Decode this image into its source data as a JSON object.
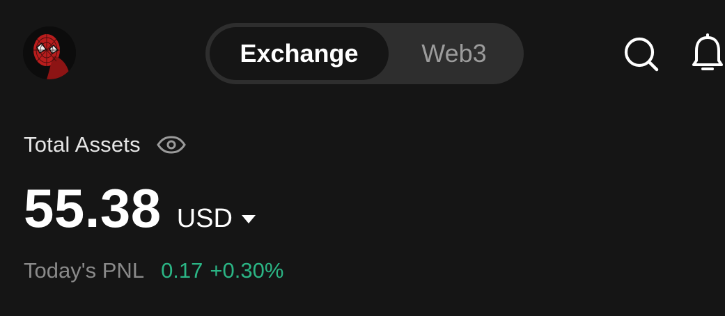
{
  "header": {
    "avatar_icon": "spider-man-avatar",
    "tabs": [
      {
        "label": "Exchange",
        "active": true
      },
      {
        "label": "Web3",
        "active": false
      }
    ],
    "search_icon": "search-icon",
    "notification_icon": "bell-icon"
  },
  "assets": {
    "label": "Total Assets",
    "visibility_icon": "eye-icon",
    "balance": "55.38",
    "currency": "USD",
    "currency_icon": "caret-down-icon",
    "pnl_label": "Today's PNL",
    "pnl_value": "0.17",
    "pnl_percent": "+0.30%"
  },
  "colors": {
    "background": "#151515",
    "segment_track": "#2e2e2e",
    "positive": "#2bb585",
    "muted": "#8a8a8a"
  }
}
